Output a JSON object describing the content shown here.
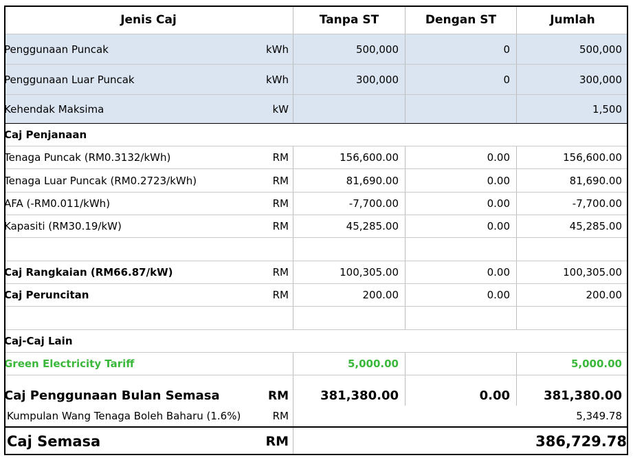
{
  "header": {
    "col_type": "Jenis Caj",
    "col_without": "Tanpa ST",
    "col_with": "Dengan ST",
    "col_total": "Jumlah"
  },
  "usage": [
    {
      "label": "Penggunaan Puncak",
      "unit": "kWh",
      "without": "500,000",
      "with": "0",
      "total": "500,000"
    },
    {
      "label": "Penggunaan Luar Puncak",
      "unit": "kWh",
      "without": "300,000",
      "with": "0",
      "total": "300,000"
    },
    {
      "label": "Kehendak Maksima",
      "unit": "kW",
      "without": "",
      "with": "",
      "total": "1,500"
    }
  ],
  "generation": {
    "section_label": "Caj Penjanaan",
    "rows": [
      {
        "label": "Tenaga Puncak  (RM0.3132/kWh)",
        "unit": "RM",
        "without": "156,600.00",
        "with": "0.00",
        "total": "156,600.00"
      },
      {
        "label": "Tenaga Luar Puncak (RM0.2723/kWh)",
        "unit": "RM",
        "without": "81,690.00",
        "with": "0.00",
        "total": "81,690.00"
      },
      {
        "label": "AFA (-RM0.011/kWh)",
        "unit": "RM",
        "without": "-7,700.00",
        "with": "0.00",
        "total": "-7,700.00"
      },
      {
        "label": "Kapasiti (RM30.19/kW)",
        "unit": "RM",
        "without": "45,285.00",
        "with": "0.00",
        "total": "45,285.00"
      }
    ]
  },
  "network": {
    "label": "Caj Rangkaian (RM66.87/kW)",
    "unit": "RM",
    "without": "100,305.00",
    "with": "0.00",
    "total": "100,305.00"
  },
  "retail": {
    "label": "Caj Peruncitan",
    "unit": "RM",
    "without": "200.00",
    "with": "0.00",
    "total": "200.00"
  },
  "other": {
    "section_label": "Caj-Caj Lain",
    "green_label": "Green Electricity Tariff",
    "green_without": "5,000.00",
    "green_total": "5,000.00"
  },
  "current_usage": {
    "label": "Caj Penggunaan Bulan Semasa",
    "unit": "RM",
    "without": "381,380.00",
    "with": "0.00",
    "total": "381,380.00"
  },
  "renewable_fund": {
    "label": "Kumpulan Wang Tenaga Boleh Baharu (1.6%)",
    "unit": "RM",
    "total": "5,349.78"
  },
  "current_charge": {
    "label": "Caj Semasa",
    "unit": "RM",
    "total": "386,729.78"
  },
  "colors": {
    "header_fill": "#ffffff",
    "usage_fill": "#dbe5f1",
    "green_text": "#3bb83b",
    "border": "#000000"
  }
}
